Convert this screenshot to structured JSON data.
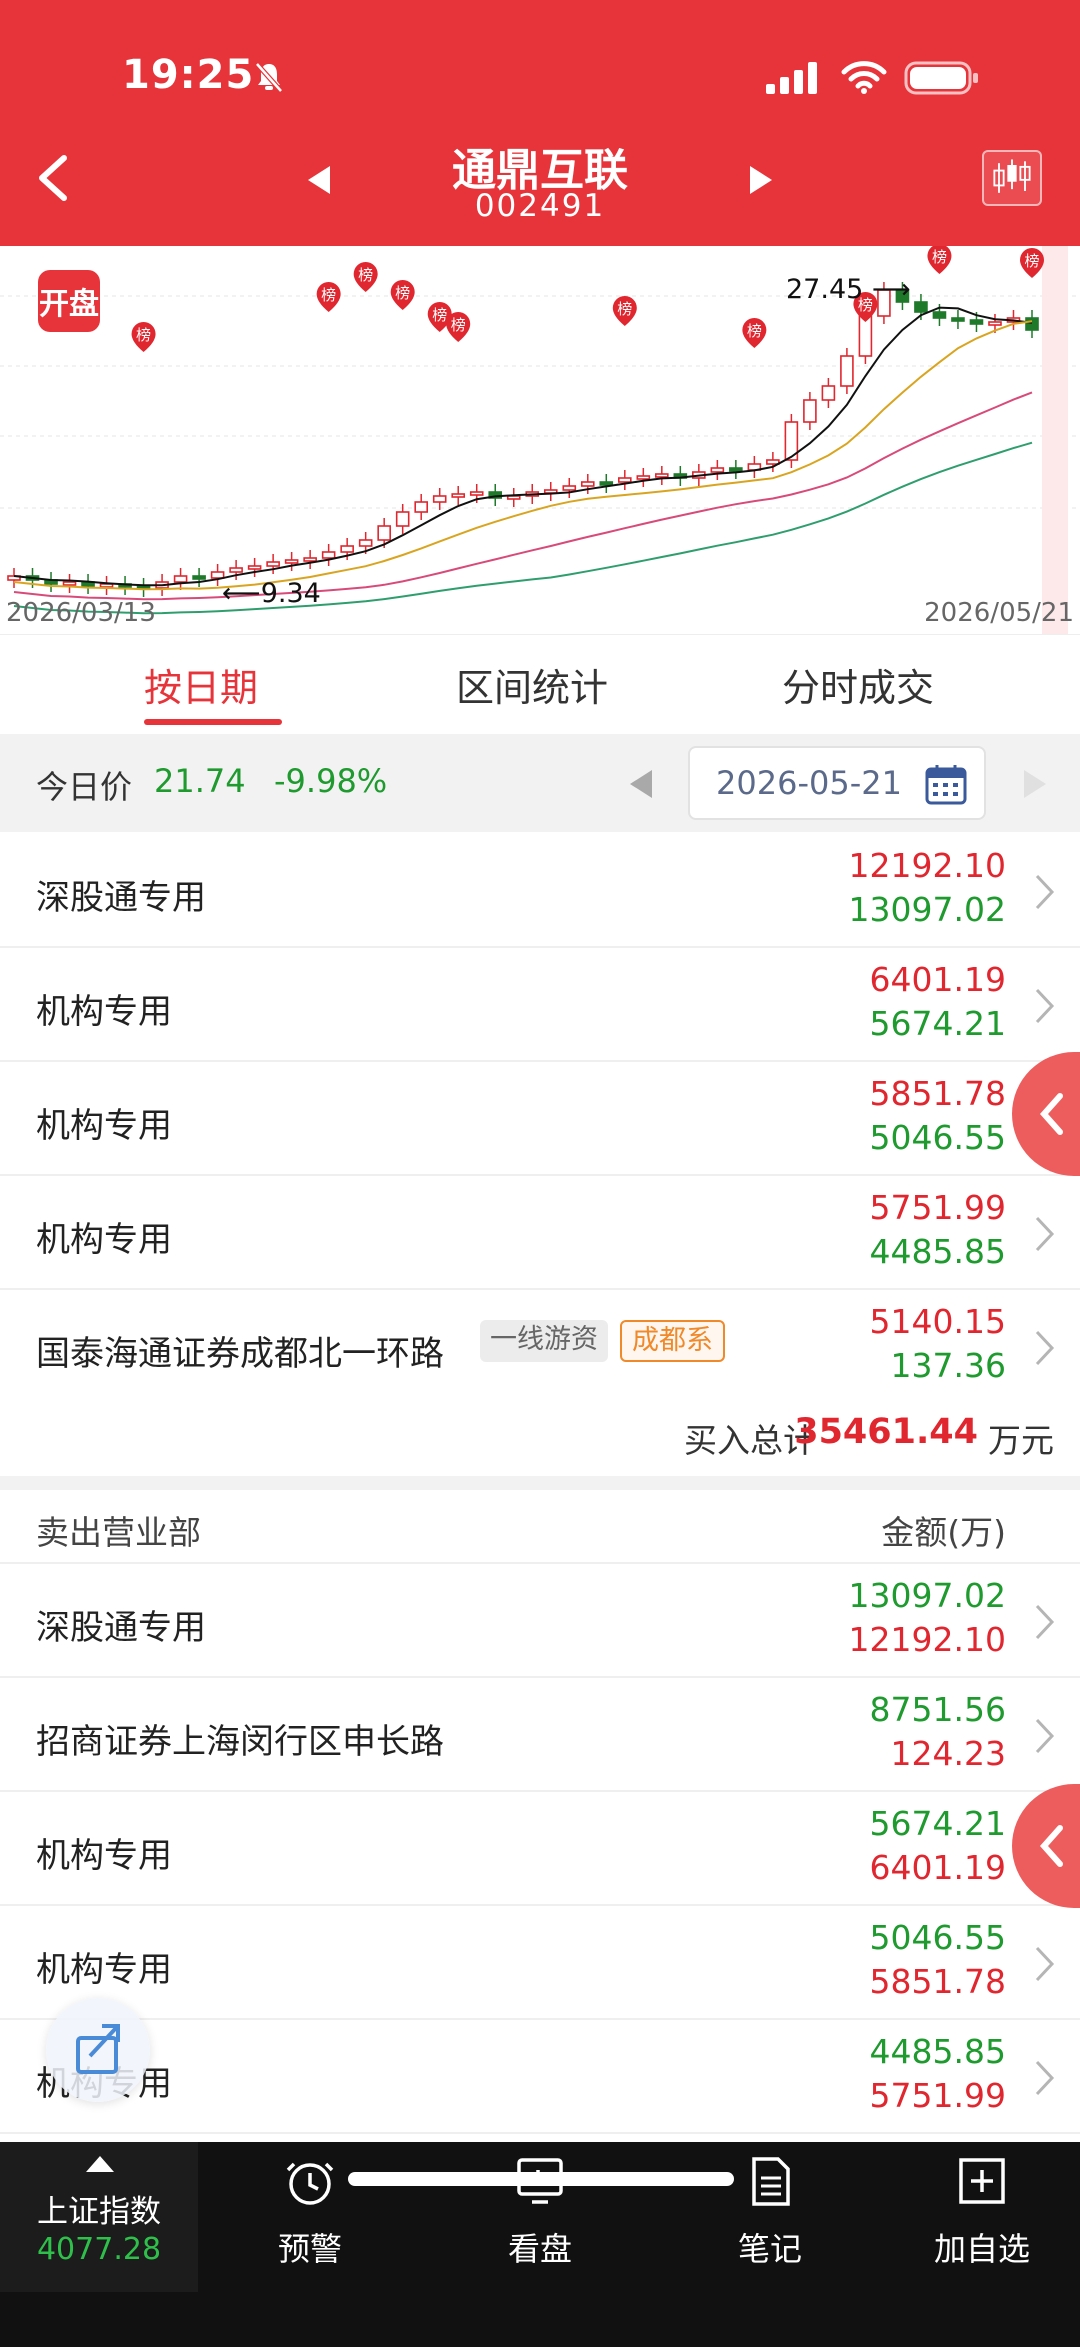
{
  "status_bar": {
    "time": "19:25"
  },
  "header": {
    "stock_name": "通鼎互联",
    "stock_code": "002491"
  },
  "chart": {
    "badge": "开盘",
    "badge_marker": "榜",
    "date_start": "2026/03/13",
    "date_end": "2026/05/21",
    "high_annotation": "27.45",
    "low_annotation": "9.34",
    "colors": {
      "up": "#e0262e",
      "down": "#1e7a2a",
      "ma5": "#111111",
      "ma10": "#d9a520",
      "ma20": "#d84a7a",
      "ma30": "#2f9e6e"
    }
  },
  "tabs": [
    {
      "label": "按日期",
      "active": true
    },
    {
      "label": "区间统计",
      "active": false
    },
    {
      "label": "分时成交",
      "active": false
    }
  ],
  "price_bar": {
    "label": "今日价",
    "price": "21.74",
    "change": "-9.98%",
    "date": "2026-05-21"
  },
  "buy_rows": [
    {
      "name": "深股通专用",
      "v1": "12192.10",
      "v2": "13097.02"
    },
    {
      "name": "机构专用",
      "v1": "6401.19",
      "v2": "5674.21"
    },
    {
      "name": "机构专用",
      "v1": "5851.78",
      "v2": "5046.55"
    },
    {
      "name": "机构专用",
      "v1": "5751.99",
      "v2": "4485.85"
    },
    {
      "name": "国泰海通证券成都北一环路",
      "v1": "5140.15",
      "v2": "137.36",
      "tags": [
        "一线游资",
        "成都系"
      ]
    }
  ],
  "buy_total": {
    "label": "买入总计",
    "value": "35461.44",
    "unit": "万元"
  },
  "sell_header": {
    "title": "卖出营业部",
    "amount_label": "金额(万)"
  },
  "sell_rows": [
    {
      "name": "深股通专用",
      "v1": "13097.02",
      "v2": "12192.10"
    },
    {
      "name": "招商证券上海闵行区申长路",
      "v1": "8751.56",
      "v2": "124.23"
    },
    {
      "name": "机构专用",
      "v1": "5674.21",
      "v2": "6401.19"
    },
    {
      "name": "机构专用",
      "v1": "5046.55",
      "v2": "5851.78"
    },
    {
      "name": "机构专用",
      "v1": "4485.85",
      "v2": "5751.99"
    }
  ],
  "bottom_nav": {
    "index_label": "上证指数",
    "index_value": "4077.28",
    "items": [
      {
        "label": "预警",
        "icon": "alarm-clock-icon"
      },
      {
        "label": "看盘",
        "icon": "monitor-chart-icon"
      },
      {
        "label": "笔记",
        "icon": "note-icon"
      },
      {
        "label": "加自选",
        "icon": "add-watchlist-icon"
      }
    ]
  }
}
